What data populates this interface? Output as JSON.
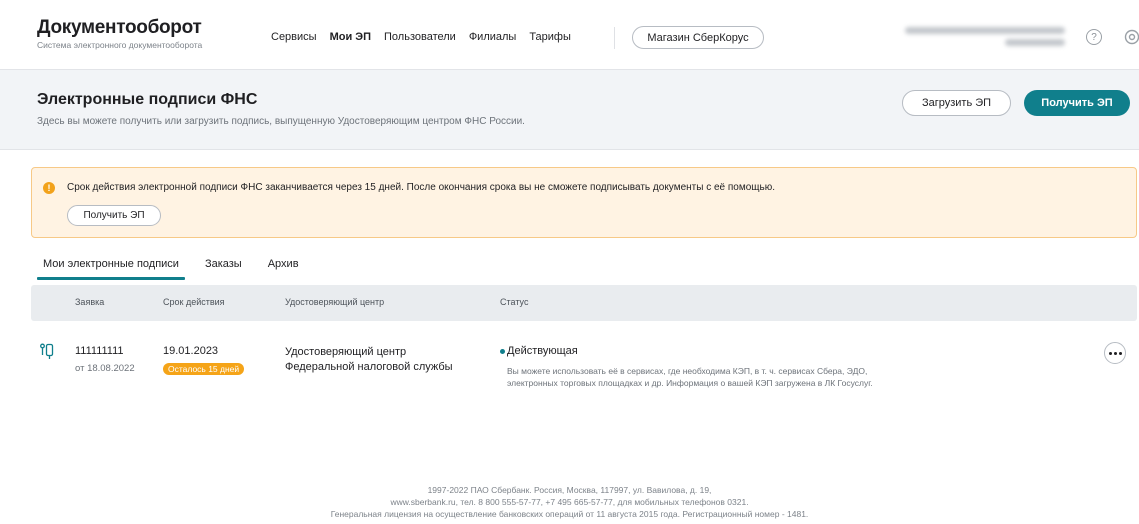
{
  "header": {
    "logo_title": "Документооборот",
    "logo_subtitle": "Система электронного документооборота",
    "nav": [
      {
        "label": "Сервисы",
        "active": false
      },
      {
        "label": "Мои ЭП",
        "active": true
      },
      {
        "label": "Пользователи",
        "active": false
      },
      {
        "label": "Филиалы",
        "active": false
      },
      {
        "label": "Тарифы",
        "active": false
      }
    ],
    "store_button": "Магазин СберКорус",
    "help_icon": "?"
  },
  "page": {
    "title": "Электронные подписи ФНС",
    "description": "Здесь вы можете получить или загрузить подпись, выпущенную Удостоверяющим центром ФНС России.",
    "upload_button": "Загрузить ЭП",
    "get_button": "Получить ЭП"
  },
  "warning": {
    "icon": "!",
    "text": "Срок действия электронной подписи ФНС заканчивается через 15 дней. После окончания срока вы не сможете подписывать документы с её помощью.",
    "button": "Получить ЭП"
  },
  "tabs": [
    {
      "label": "Мои электронные подписи",
      "active": true
    },
    {
      "label": "Заказы",
      "active": false
    },
    {
      "label": "Архив",
      "active": false
    }
  ],
  "table": {
    "headers": [
      "Заявка",
      "Срок действия",
      "Удостоверяющий центр",
      "Статус"
    ],
    "rows": [
      {
        "request_number": "111111111",
        "request_date": "от 18.08.2022",
        "expiry_date": "19.01.2023",
        "remaining": "Осталось 15 дней",
        "ca_line1": "Удостоверяющий центр",
        "ca_line2": "Федеральной налоговой службы",
        "status": "Действующая",
        "status_color": "#107f8c",
        "status_note": "Вы можете использовать её в сервисах, где необходима КЭП, в т. ч. сервисах Сбера, ЭДО, электронных торговых площадках и др. Информация о вашей КЭП загружена в ЛК Госуслуг."
      }
    ]
  },
  "footer": {
    "line1": "1997-2022 ПАО Сбербанк. Россия, Москва, 117997, ул. Вавилова, д. 19,",
    "line2": "www.sberbank.ru, тел. 8 800 555-57-77, +7 495 665-57-77, для мобильных телефонов 0321.",
    "line3": "Генеральная лицензия на осуществление банковских операций от 11 августа 2015 года. Регистрационный номер - 1481."
  },
  "colors": {
    "accent": "#107f8c",
    "warning_bg": "#fff3e3",
    "warning_border": "#f7c987",
    "badge": "#f5a418"
  }
}
